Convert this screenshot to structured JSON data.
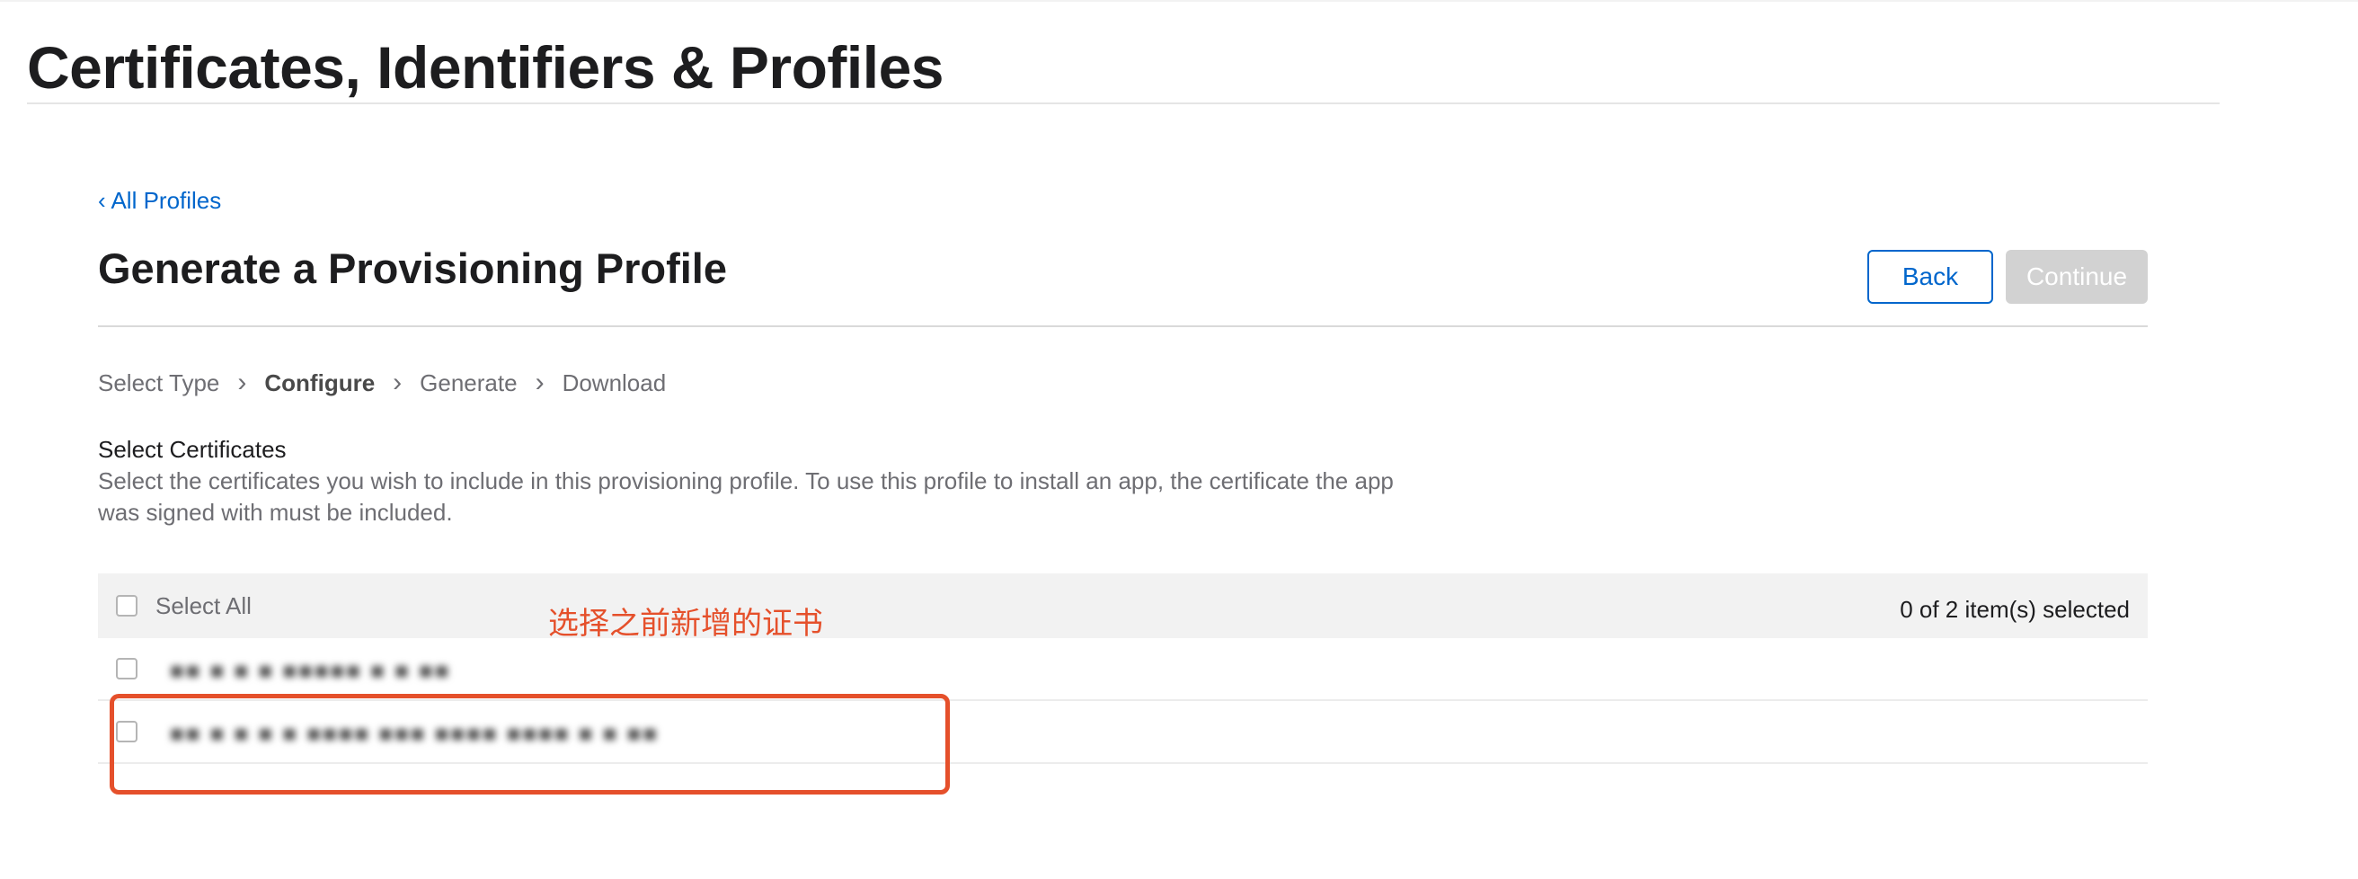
{
  "site": {
    "title": "Certificates, Identifiers & Profiles"
  },
  "nav": {
    "back_link": "‹ All Profiles"
  },
  "page": {
    "heading": "Generate a Provisioning Profile"
  },
  "buttons": {
    "back": "Back",
    "continue": "Continue"
  },
  "steps": [
    {
      "label": "Select Type",
      "state": "done"
    },
    {
      "label": "Configure",
      "state": "current"
    },
    {
      "label": "Generate",
      "state": "pending"
    },
    {
      "label": "Download",
      "state": "pending"
    }
  ],
  "step_separator": "›",
  "section": {
    "title": "Select Certificates",
    "description": "Select the certificates you wish to include in this provisioning profile. To use this profile to install an app, the certificate the app was signed with must be included."
  },
  "table": {
    "select_all_label": "Select All",
    "selection_count": "0 of 2 item(s) selected",
    "rows": [
      {
        "name": "■■ ■ ■ ■ ■■■■■ ■ ■ ■■",
        "checked": false
      },
      {
        "name": "■■ ■ ■ ■ ■ ■■■■ ■■■ ■■■■ ■■■■ ■ ■ ■■",
        "checked": false
      }
    ]
  },
  "annotation": {
    "text": "选择之前新增的证书",
    "color": "#e5502b"
  },
  "colors": {
    "accent": "#0066cc",
    "disabled_button": "#d2d2d2",
    "header_bg": "#f2f2f2"
  }
}
